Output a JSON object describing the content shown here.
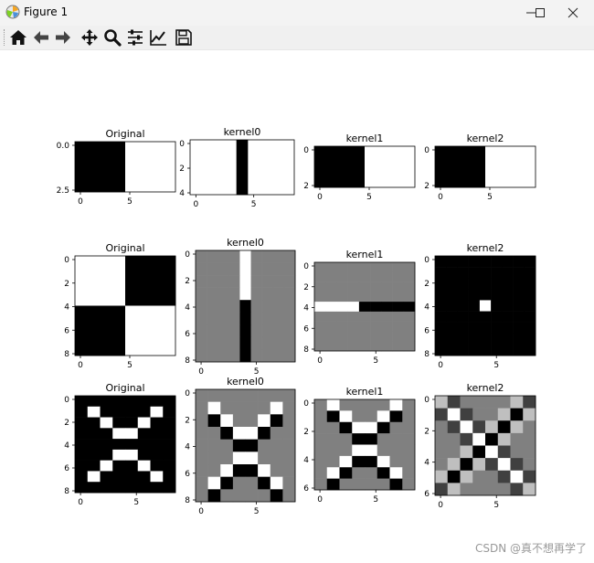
{
  "window": {
    "title": "Figure 1"
  },
  "toolbar": {
    "buttons": [
      {
        "name": "home-button",
        "icon": "home-icon"
      },
      {
        "name": "back-button",
        "icon": "arrow-left-icon"
      },
      {
        "name": "forward-button",
        "icon": "arrow-right-icon"
      },
      {
        "name": "pan-button",
        "icon": "move-icon"
      },
      {
        "name": "zoom-button",
        "icon": "magnifier-icon"
      },
      {
        "name": "configure-subplots-button",
        "icon": "sliders-icon"
      },
      {
        "name": "edit-axis-button",
        "icon": "line-chart-icon"
      },
      {
        "name": "save-button",
        "icon": "floppy-disk-icon"
      }
    ]
  },
  "watermark": "CSDN @真不想再学了",
  "chart_data": [
    {
      "type": "heatmap",
      "title": "Original",
      "rows": 1,
      "cols": 2,
      "values": [
        [
          0,
          1
        ]
      ],
      "xticks": [
        "0",
        "5"
      ],
      "yticks": [
        "0.0",
        "2.5"
      ]
    },
    {
      "type": "heatmap",
      "title": "kernel0",
      "rows": 5,
      "cols": 9,
      "values": [
        [
          1,
          1,
          1,
          1,
          0,
          1,
          1,
          1,
          1
        ],
        [
          1,
          1,
          1,
          1,
          0,
          1,
          1,
          1,
          1
        ],
        [
          1,
          1,
          1,
          1,
          0,
          1,
          1,
          1,
          1
        ],
        [
          1,
          1,
          1,
          1,
          0,
          1,
          1,
          1,
          1
        ],
        [
          1,
          1,
          1,
          1,
          0,
          1,
          1,
          1,
          1
        ]
      ],
      "xticks": [
        "0",
        "5"
      ],
      "yticks": [
        "0",
        "2",
        "4"
      ]
    },
    {
      "type": "heatmap",
      "title": "kernel1",
      "rows": 1,
      "cols": 2,
      "values": [
        [
          0,
          1
        ]
      ],
      "xticks": [
        "0",
        "5"
      ],
      "yticks": [
        "0",
        "2"
      ]
    },
    {
      "type": "heatmap",
      "title": "kernel2",
      "rows": 1,
      "cols": 2,
      "values": [
        [
          0,
          1
        ]
      ],
      "xticks": [
        "0",
        "5"
      ],
      "yticks": [
        "0",
        "2"
      ]
    },
    {
      "type": "heatmap",
      "title": "Original",
      "rows": 2,
      "cols": 2,
      "values": [
        [
          1,
          0
        ],
        [
          0,
          1
        ]
      ],
      "xticks": [
        "0",
        "5"
      ],
      "yticks": [
        "0",
        "2",
        "4",
        "6",
        "8"
      ]
    },
    {
      "type": "heatmap",
      "title": "kernel0",
      "rows": 9,
      "cols": 9,
      "values": [
        [
          0.5,
          0.5,
          0.5,
          0.5,
          1,
          0.5,
          0.5,
          0.5,
          0.5
        ],
        [
          0.5,
          0.5,
          0.5,
          0.5,
          1,
          0.5,
          0.5,
          0.5,
          0.5
        ],
        [
          0.5,
          0.5,
          0.5,
          0.5,
          1,
          0.5,
          0.5,
          0.5,
          0.5
        ],
        [
          0.5,
          0.5,
          0.5,
          0.5,
          1,
          0.5,
          0.5,
          0.5,
          0.5
        ],
        [
          0.5,
          0.5,
          0.5,
          0.5,
          0,
          0.5,
          0.5,
          0.5,
          0.5
        ],
        [
          0.5,
          0.5,
          0.5,
          0.5,
          0,
          0.5,
          0.5,
          0.5,
          0.5
        ],
        [
          0.5,
          0.5,
          0.5,
          0.5,
          0,
          0.5,
          0.5,
          0.5,
          0.5
        ],
        [
          0.5,
          0.5,
          0.5,
          0.5,
          0,
          0.5,
          0.5,
          0.5,
          0.5
        ],
        [
          0.5,
          0.5,
          0.5,
          0.5,
          0,
          0.5,
          0.5,
          0.5,
          0.5
        ]
      ],
      "xticks": [
        "0",
        "5"
      ],
      "yticks": [
        "0",
        "2",
        "4",
        "6",
        "8"
      ]
    },
    {
      "type": "heatmap",
      "title": "kernel1",
      "rows": 9,
      "cols": 9,
      "values": [
        [
          0.5,
          0.5,
          0.5,
          0.5,
          0.5,
          0.5,
          0.5,
          0.5,
          0.5
        ],
        [
          0.5,
          0.5,
          0.5,
          0.5,
          0.5,
          0.5,
          0.5,
          0.5,
          0.5
        ],
        [
          0.5,
          0.5,
          0.5,
          0.5,
          0.5,
          0.5,
          0.5,
          0.5,
          0.5
        ],
        [
          0.5,
          0.5,
          0.5,
          0.5,
          0.5,
          0.5,
          0.5,
          0.5,
          0.5
        ],
        [
          1,
          1,
          1,
          1,
          0,
          0,
          0,
          0,
          0
        ],
        [
          0.5,
          0.5,
          0.5,
          0.5,
          0.5,
          0.5,
          0.5,
          0.5,
          0.5
        ],
        [
          0.5,
          0.5,
          0.5,
          0.5,
          0.5,
          0.5,
          0.5,
          0.5,
          0.5
        ],
        [
          0.5,
          0.5,
          0.5,
          0.5,
          0.5,
          0.5,
          0.5,
          0.5,
          0.5
        ],
        [
          0.5,
          0.5,
          0.5,
          0.5,
          0.5,
          0.5,
          0.5,
          0.5,
          0.5
        ]
      ],
      "xticks": [
        "0",
        "5"
      ],
      "yticks": [
        "0",
        "2",
        "4",
        "6",
        "8"
      ]
    },
    {
      "type": "heatmap",
      "title": "kernel2",
      "rows": 9,
      "cols": 9,
      "values": [
        [
          0,
          0,
          0,
          0,
          0,
          0,
          0,
          0,
          0
        ],
        [
          0,
          0,
          0,
          0,
          0,
          0,
          0,
          0,
          0
        ],
        [
          0,
          0,
          0,
          0,
          0,
          0,
          0,
          0,
          0
        ],
        [
          0,
          0,
          0,
          0,
          0,
          0,
          0,
          0,
          0
        ],
        [
          0,
          0,
          0,
          0,
          1,
          0,
          0,
          0,
          0
        ],
        [
          0,
          0,
          0,
          0,
          0,
          0,
          0,
          0,
          0
        ],
        [
          0,
          0,
          0,
          0,
          0,
          0,
          0,
          0,
          0
        ],
        [
          0,
          0,
          0,
          0,
          0,
          0,
          0,
          0,
          0
        ],
        [
          0,
          0,
          0,
          0,
          0,
          0,
          0,
          0,
          0
        ]
      ],
      "xticks": [
        "0",
        "5"
      ],
      "yticks": [
        "0",
        "2",
        "4",
        "6",
        "8"
      ]
    },
    {
      "type": "heatmap",
      "title": "Original",
      "rows": 9,
      "cols": 8,
      "values": [
        [
          0,
          0,
          0,
          0,
          0,
          0,
          0,
          0
        ],
        [
          0,
          1,
          0,
          0,
          0,
          0,
          1,
          0
        ],
        [
          0,
          0,
          1,
          0,
          0,
          1,
          0,
          0
        ],
        [
          0,
          0,
          0,
          1,
          1,
          0,
          0,
          0
        ],
        [
          0,
          0,
          0,
          0,
          0,
          0,
          0,
          0
        ],
        [
          0,
          0,
          0,
          1,
          1,
          0,
          0,
          0
        ],
        [
          0,
          0,
          1,
          0,
          0,
          1,
          0,
          0
        ],
        [
          0,
          1,
          0,
          0,
          0,
          0,
          1,
          0
        ],
        [
          0,
          0,
          0,
          0,
          0,
          0,
          0,
          0
        ]
      ],
      "xticks": [
        "0",
        "5"
      ],
      "yticks": [
        "0",
        "2",
        "4",
        "6",
        "8"
      ]
    },
    {
      "type": "heatmap",
      "title": "kernel0",
      "rows": 9,
      "cols": 8,
      "values": [
        [
          0.5,
          0.5,
          0.5,
          0.5,
          0.5,
          0.5,
          0.5,
          0.5
        ],
        [
          0.5,
          1,
          0.5,
          0.5,
          0.5,
          0.5,
          1,
          0.5
        ],
        [
          0.5,
          0,
          1,
          0.5,
          0.5,
          1,
          0,
          0.5
        ],
        [
          0.5,
          0.5,
          0,
          1,
          1,
          0,
          0.5,
          0.5
        ],
        [
          0.5,
          0.5,
          0.5,
          0,
          0,
          0.5,
          0.5,
          0.5
        ],
        [
          0.5,
          0.5,
          0.5,
          1,
          1,
          0.5,
          0.5,
          0.5
        ],
        [
          0.5,
          0.5,
          1,
          0,
          0,
          1,
          0.5,
          0.5
        ],
        [
          0.5,
          1,
          0,
          0.5,
          0.5,
          0,
          1,
          0.5
        ],
        [
          0.5,
          0,
          0.5,
          0.5,
          0.5,
          0.5,
          0,
          0.5
        ]
      ],
      "xticks": [
        "0",
        "5"
      ],
      "yticks": [
        "0",
        "2",
        "4",
        "6",
        "8"
      ]
    },
    {
      "type": "heatmap",
      "title": "kernel1",
      "rows": 8,
      "cols": 8,
      "values": [
        [
          0.5,
          1,
          0.5,
          0.5,
          0.5,
          0.5,
          1,
          0.5
        ],
        [
          0.5,
          0,
          1,
          0.5,
          0.5,
          1,
          0,
          0.5
        ],
        [
          0.5,
          0.5,
          0,
          1,
          1,
          0,
          0.5,
          0.5
        ],
        [
          0.5,
          0.5,
          0.5,
          0,
          0,
          0.5,
          0.5,
          0.5
        ],
        [
          0.5,
          0.5,
          0.5,
          1,
          1,
          0.5,
          0.5,
          0.5
        ],
        [
          0.5,
          0.5,
          1,
          0,
          0,
          1,
          0.5,
          0.5
        ],
        [
          0.5,
          1,
          0,
          0.5,
          0.5,
          0,
          1,
          0.5
        ],
        [
          0.5,
          0,
          0.5,
          0.5,
          0.5,
          0.5,
          0,
          0.5
        ]
      ],
      "xticks": [
        "0",
        "5"
      ],
      "yticks": [
        "0",
        "2",
        "4",
        "6"
      ]
    },
    {
      "type": "heatmap",
      "title": "kernel2",
      "rows": 8,
      "cols": 8,
      "values": [
        [
          0.75,
          0.25,
          0.5,
          0.5,
          0.5,
          0.5,
          0.75,
          0.25
        ],
        [
          0.25,
          1,
          0.25,
          0.5,
          0.5,
          0.75,
          0,
          0.75
        ],
        [
          0.5,
          0.25,
          1,
          0.25,
          0.75,
          0,
          0.75,
          0.5
        ],
        [
          0.5,
          0.5,
          0.25,
          1,
          0,
          0.75,
          0.5,
          0.5
        ],
        [
          0.5,
          0.5,
          0.75,
          0,
          1,
          0.25,
          0.5,
          0.5
        ],
        [
          0.5,
          0.75,
          0,
          0.75,
          0.25,
          1,
          0.25,
          0.5
        ],
        [
          0.75,
          0,
          0.75,
          0.5,
          0.5,
          0.25,
          1,
          0.25
        ],
        [
          0.25,
          0.75,
          0.5,
          0.5,
          0.5,
          0.5,
          0.25,
          0.75
        ]
      ],
      "xticks": [
        "0",
        "5"
      ],
      "yticks": [
        "0",
        "2",
        "4",
        "6"
      ]
    }
  ]
}
